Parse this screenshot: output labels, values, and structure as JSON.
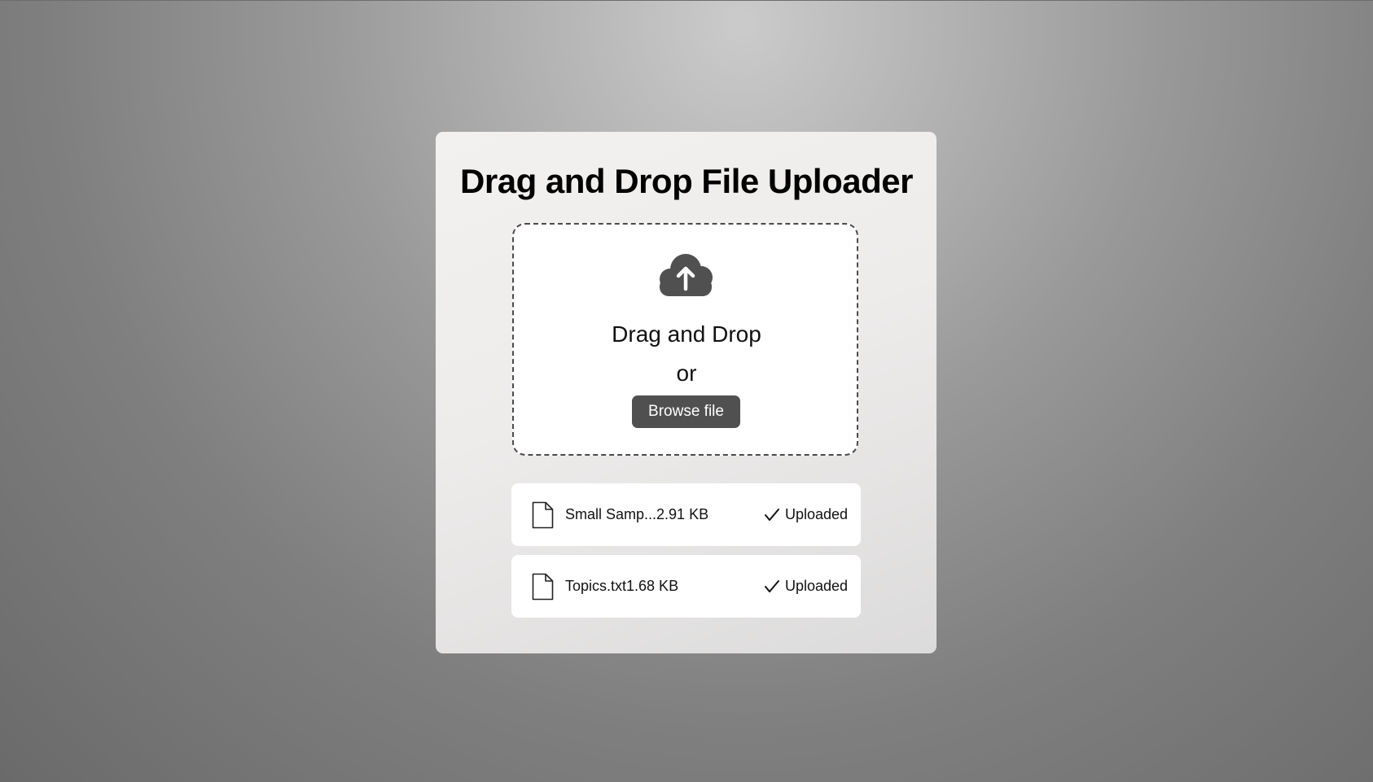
{
  "uploader": {
    "title": "Drag and Drop File Uploader",
    "dropzone": {
      "icon": "cloud-upload-icon",
      "drag_text": "Drag and Drop",
      "or_text": "or",
      "browse_label": "Browse file"
    },
    "files": [
      {
        "name": "Small Samp...2.91 KB",
        "status": "Uploaded",
        "icon": "file-icon",
        "status_icon": "checkmark-icon"
      },
      {
        "name": "Topics.txt1.68 KB",
        "status": "Uploaded",
        "icon": "file-icon",
        "status_icon": "checkmark-icon"
      }
    ]
  },
  "colors": {
    "button_bg": "#505050",
    "icon_color": "#505050",
    "card_bg": "#f0eeed",
    "text": "#000000"
  }
}
